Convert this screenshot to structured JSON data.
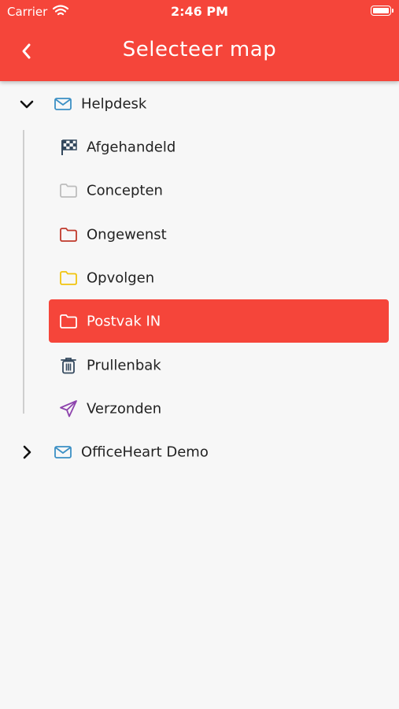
{
  "status_bar": {
    "carrier": "Carrier",
    "time": "2:46 PM"
  },
  "header": {
    "title": "Selecteer map",
    "back_icon": "chevron-left-icon"
  },
  "colors": {
    "accent": "#f5453a",
    "mail_icon": "#3b8fc4",
    "folder_gray": "#bdbdbd",
    "folder_red": "#c0392b",
    "folder_yellow": "#f1c40f",
    "sent_purple": "#8e44ad",
    "dark_icon": "#34495e"
  },
  "accounts": [
    {
      "name": "Helpdesk",
      "expanded": true,
      "icon": "mail-icon"
    },
    {
      "name": "OfficeHeart Demo",
      "expanded": false,
      "icon": "mail-icon"
    }
  ],
  "folders": [
    {
      "label": "Afgehandeld",
      "icon": "checkered-flag-icon"
    },
    {
      "label": "Concepten",
      "icon": "folder-icon"
    },
    {
      "label": "Ongewenst",
      "icon": "folder-icon"
    },
    {
      "label": "Opvolgen",
      "icon": "folder-icon"
    },
    {
      "label": "Postvak IN",
      "icon": "folder-icon",
      "selected": true
    },
    {
      "label": "Prullenbak",
      "icon": "trash-icon"
    },
    {
      "label": "Verzonden",
      "icon": "paper-plane-icon"
    }
  ]
}
